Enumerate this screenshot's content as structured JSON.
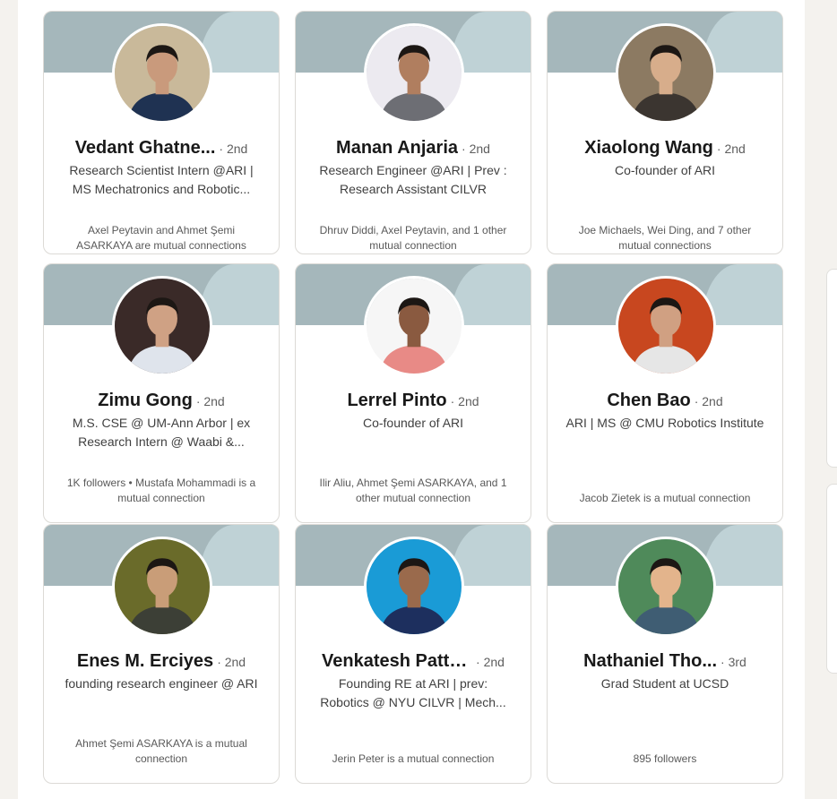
{
  "cards": [
    {
      "name": "Vedant Ghatne...",
      "degree": "· 2nd",
      "headline": "Research Scientist Intern @ARI | MS Mechatronics and Robotic...",
      "mutual": "Axel Peytavin and Ahmet Şemi ASARKAYA are mutual connections",
      "avatar_bg": "#c9b99a",
      "avatar_shirt": "#1f3252",
      "avatar_skin": "#c99a7c"
    },
    {
      "name": "Manan Anjaria",
      "degree": "· 2nd",
      "headline": "Research Engineer @ARI | Prev : Research Assistant CILVR",
      "mutual": "Dhruv Diddi, Axel Peytavin, and 1 other mutual connection",
      "avatar_bg": "#eceaf0",
      "avatar_shirt": "#6d6e74",
      "avatar_skin": "#b07e5f"
    },
    {
      "name": "Xiaolong Wang",
      "degree": "· 2nd",
      "headline": "Co-founder of ARI",
      "mutual": "Joe Michaels, Wei Ding, and 7 other mutual connections",
      "avatar_bg": "#8c7a62",
      "avatar_shirt": "#3b3530",
      "avatar_skin": "#d7ad8b"
    },
    {
      "name": "Zimu Gong",
      "degree": "· 2nd",
      "headline": "M.S. CSE @ UM-Ann Arbor | ex Research Intern @ Waabi &...",
      "mutual": "1K followers • Mustafa Mohammadi is a mutual connection",
      "avatar_bg": "#3a2a28",
      "avatar_shirt": "#dfe4ec",
      "avatar_skin": "#cfa184"
    },
    {
      "name": "Lerrel Pinto",
      "degree": "· 2nd",
      "headline": "Co-founder of ARI",
      "mutual": "Ilir Aliu, Ahmet Şemi ASARKAYA, and 1 other mutual connection",
      "avatar_bg": "#f6f6f6",
      "avatar_shirt": "#e88a86",
      "avatar_skin": "#8a5a40"
    },
    {
      "name": "Chen Bao",
      "degree": "· 2nd",
      "headline": "ARI | MS @ CMU Robotics Institute",
      "mutual": "Jacob Zietek is a mutual connection",
      "avatar_bg": "#c8471f",
      "avatar_shirt": "#e6e6e6",
      "avatar_skin": "#d0a082"
    },
    {
      "name": "Enes M. Erciyes",
      "degree": "· 2nd",
      "headline": "founding research engineer @ ARI",
      "mutual": "Ahmet Şemi ASARKAYA is a mutual connection",
      "avatar_bg": "#6a6b2a",
      "avatar_shirt": "#3c3f36",
      "avatar_skin": "#c99d78"
    },
    {
      "name": "Venkatesh Patta...",
      "degree": "· 2nd",
      "headline": "Founding RE at ARI | prev: Robotics @ NYU CILVR | Mech...",
      "mutual": "Jerin Peter is a mutual connection",
      "avatar_bg": "#1a9bd6",
      "avatar_shirt": "#1d2f5e",
      "avatar_skin": "#9a6a4c"
    },
    {
      "name": "Nathaniel Tho...",
      "degree": "· 3rd",
      "headline": "Grad Student at UCSD",
      "mutual": "895 followers",
      "avatar_bg": "#4f8a5a",
      "avatar_shirt": "#3f5d73",
      "avatar_skin": "#e3b48c"
    }
  ]
}
